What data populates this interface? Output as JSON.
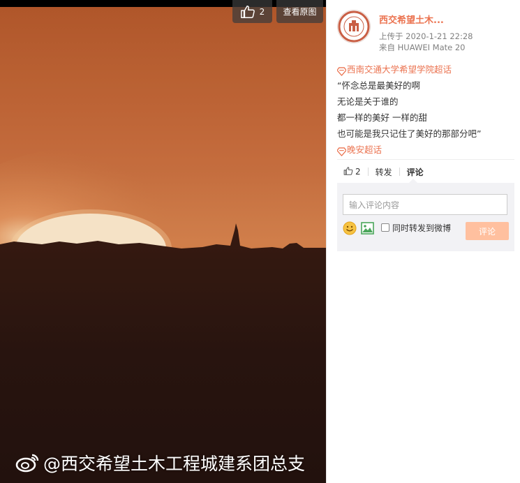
{
  "photo": {
    "like_count": "2",
    "view_original_label": "查看原图",
    "watermark_text": "@西交希望土木工程城建系团总支"
  },
  "author": {
    "name": "西交希望土木...",
    "upload_time": "上传于 2020-1-21 22:28",
    "device": "来自 HUAWEI Mate 20"
  },
  "post": {
    "topic_1": "西南交通大学希望学院超话",
    "lines": [
      "“怀念总是最美好的啊",
      "无论是关于谁的",
      "都一样的美好 一样的甜",
      "也可能是我只记住了美好的那部分吧”"
    ],
    "topic_2": "晚安超话"
  },
  "actions": {
    "like_count": "2",
    "repost_label": "转发",
    "comment_label": "评论"
  },
  "comment_box": {
    "placeholder": "输入评论内容",
    "repost_label": "同时转发到微博",
    "submit_label": "评论"
  },
  "colors": {
    "accent": "#eb7350",
    "submit_disabled": "#ffc09f",
    "sky": "#c9713c",
    "ground": "#2a1510"
  },
  "icons": [
    "thumb-up-icon",
    "super-topic-icon",
    "emoji-icon",
    "image-icon",
    "weibo-logo-icon"
  ]
}
